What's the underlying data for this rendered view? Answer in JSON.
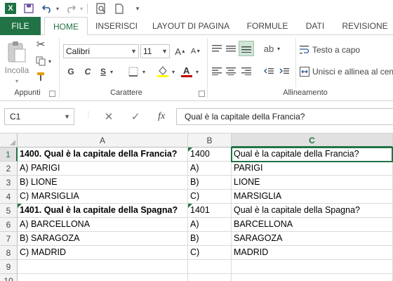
{
  "qat": {
    "icons": [
      "excel-logo",
      "save-icon",
      "undo-icon",
      "redo-icon",
      "print-preview-icon",
      "new-file-icon",
      "customize-icon"
    ],
    "logo_letter": "X"
  },
  "tabs": [
    {
      "label": "FILE"
    },
    {
      "label": "HOME"
    },
    {
      "label": "INSERISCI"
    },
    {
      "label": "LAYOUT DI PAGINA"
    },
    {
      "label": "FORMULE"
    },
    {
      "label": "DATI"
    },
    {
      "label": "REVISIONE"
    }
  ],
  "ribbon": {
    "clipboard": {
      "paste_label": "Incolla",
      "group_label": "Appunti"
    },
    "font": {
      "name": "Calibri",
      "size": "11",
      "grow": "A",
      "shrink": "A",
      "bold": "G",
      "italic": "C",
      "underline": "S",
      "group_label": "Carattere"
    },
    "alignment": {
      "wrap_label": "Testo a capo",
      "merge_label": "Unisci e allinea al centro",
      "group_label": "Allineamento"
    }
  },
  "formula_bar": {
    "name_box": "C1",
    "fx": "fx",
    "content": "Qual è la capitale della Francia?"
  },
  "sheet": {
    "columns": [
      "A",
      "B",
      "C"
    ],
    "selected_column": "C",
    "selected_row": "1",
    "rows": [
      {
        "n": "1",
        "a": "1400. Qual è la capitale della Francia?",
        "b": "1400",
        "c": "Qual è la capitale della Francia?",
        "bold": true,
        "b_flag": true
      },
      {
        "n": "2",
        "a": "A) PARIGI",
        "b": "A)",
        "c": "PARIGI"
      },
      {
        "n": "3",
        "a": "B) LIONE",
        "b": "B)",
        "c": "LIONE"
      },
      {
        "n": "4",
        "a": "C) MARSIGLIA",
        "b": "C)",
        "c": "MARSIGLIA"
      },
      {
        "n": "5",
        "a": "1401. Qual è la capitale della Spagna?",
        "b": "1401",
        "c": "Qual è la capitale della Spagna?",
        "bold": true,
        "a_flag": true,
        "b_flag": true
      },
      {
        "n": "6",
        "a": "A) BARCELLONA",
        "b": "A)",
        "c": "BARCELLONA"
      },
      {
        "n": "7",
        "a": "B) SARAGOZA",
        "b": "B)",
        "c": "SARAGOZA"
      },
      {
        "n": "8",
        "a": "C) MADRID",
        "b": "C)",
        "c": "MADRID"
      },
      {
        "n": "9",
        "a": "",
        "b": "",
        "c": ""
      },
      {
        "n": "10",
        "a": "",
        "b": "",
        "c": ""
      }
    ]
  },
  "colors": {
    "accent": "#217346",
    "font_highlight": "#ffff00",
    "font_color": "#c00000"
  }
}
